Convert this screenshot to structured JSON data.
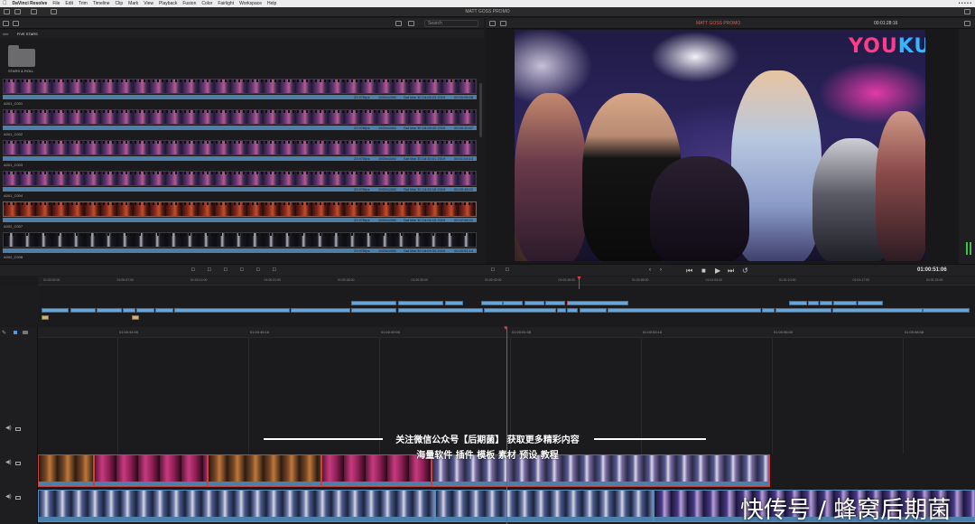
{
  "menubar": {
    "app": "DaVinci Resolve",
    "items": [
      "File",
      "Edit",
      "Trim",
      "Timeline",
      "Clip",
      "Mark",
      "View",
      "Playback",
      "Fusion",
      "Color",
      "Fairlight",
      "Workspace",
      "Help"
    ],
    "status": "• • • • •"
  },
  "window": {
    "title": "MATT GOSS PROMO"
  },
  "media_pool": {
    "search_placeholder": "Search",
    "breadcrumb_parent": "ster",
    "breadcrumb_current": "FIVE STARS",
    "folder_label": "STARS & ROLL",
    "clips": [
      {
        "name": "A001_C001",
        "fps": "23.976fps",
        "res": "1920x1080",
        "date": "Sat Mar 30 18:26:23 2019",
        "dur": "00:00:06:08",
        "style": ""
      },
      {
        "name": "A001_C002",
        "fps": "23.976fps",
        "res": "1920x1080",
        "date": "Sat Mar 30 18:28:40 2019",
        "dur": "00:00:10:07",
        "style": ""
      },
      {
        "name": "A001_C003",
        "fps": "23.976fps",
        "res": "1920x1080",
        "date": "Sat Mar 30 18:30:01 2019",
        "dur": "00:01:04:13",
        "style": ""
      },
      {
        "name": "A001_C004",
        "fps": "23.976fps",
        "res": "1920x1080",
        "date": "Sat Mar 30 18:32:18 2019",
        "dur": "00:00:48:22",
        "style": ""
      },
      {
        "name": "A002_C007",
        "fps": "23.976fps",
        "res": "1920x1080",
        "date": "Sat Mar 30 18:06:15 2019",
        "dur": "00:02:58:21",
        "style": "sel"
      },
      {
        "name": "A002_C008",
        "fps": "23.976fps",
        "res": "1920x1080",
        "date": "Sat Mar 30 18:09:34 2019",
        "dur": "00:00:51:14",
        "style": "dark"
      }
    ]
  },
  "viewer": {
    "title": "MATT GOSS PROMO",
    "timecode": "00:01:28:16",
    "logo_left": "YOU",
    "logo_right": "KU",
    "playhead_tc": "01:00:51:06"
  },
  "mini_timeline": {
    "ruler": [
      "01:00:00:00",
      "01:00:07:00",
      "01:00:14:00",
      "01:00:21:00",
      "01:00:28:00",
      "01:00:35:00",
      "01:00:42:00",
      "01:00:49:00",
      "01:00:56:00",
      "01:01:03:00",
      "01:01:10:00",
      "01:01:17:00",
      "01:01:24:00"
    ]
  },
  "timeline": {
    "ruler": [
      "01:00:44:00",
      "01:00:46:16",
      "01:00:49:00",
      "01:00:51:08",
      "01:00:53:16",
      "01:00:56:00",
      "01:00:58:08"
    ]
  },
  "overlay": {
    "caption_line1": "关注微信公众号【后期菌】 获取更多精彩内容",
    "caption_line2": "海量软件 插件 模板 素材 预设 教程",
    "watermark": "快传号 / 蜂窝后期菌"
  },
  "colors": {
    "accent_red": "#c8443b",
    "clip_blue": "#4d7fab",
    "meter_green": "#3ec24e"
  }
}
